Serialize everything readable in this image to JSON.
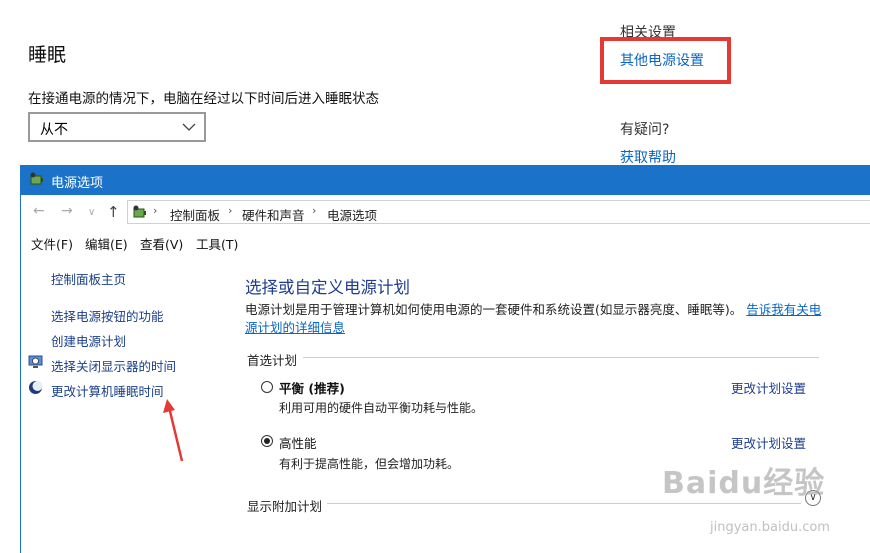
{
  "settings": {
    "sleep_title": "睡眠",
    "sleep_desc": "在接通电源的情况下，电脑在经过以下时间后进入睡眠状态",
    "sleep_value": "从不",
    "related_title": "相关设置",
    "other_power_link": "其他电源设置",
    "question_title": "有疑问?",
    "help_link": "获取帮助"
  },
  "window": {
    "title": "电源选项",
    "breadcrumb": [
      "控制面板",
      "硬件和声音",
      "电源选项"
    ],
    "menu": [
      "文件(F)",
      "编辑(E)",
      "查看(V)",
      "工具(T)"
    ]
  },
  "sidebar": {
    "items": [
      {
        "label": "控制面板主页",
        "icon": ""
      },
      {
        "label": "选择电源按钮的功能",
        "icon": ""
      },
      {
        "label": "创建电源计划",
        "icon": ""
      },
      {
        "label": "选择关闭显示器的时间",
        "icon": "monitor-clock-icon"
      },
      {
        "label": "更改计算机睡眠时间",
        "icon": "moon-icon"
      }
    ]
  },
  "main": {
    "title": "选择或自定义电源计划",
    "desc_text": "电源计划是用于管理计算机如何使用电源的一套硬件和系统设置(如显示器亮度、睡眠等)。",
    "desc_link": "告诉我有关电源计划的详细信息",
    "preferred_label": "首选计划",
    "plans": [
      {
        "name": "平衡 (推荐)",
        "desc": "利用可用的硬件自动平衡功耗与性能。",
        "link": "更改计划设置",
        "selected": false
      },
      {
        "name": "高性能",
        "desc": "有利于提高性能，但会增加功耗。",
        "link": "更改计划设置",
        "selected": true
      }
    ],
    "extra_label": "显示附加计划"
  },
  "watermark": {
    "line1": "Baidu经验",
    "line2": "jingyan.baidu.com"
  },
  "colors": {
    "accent": "#1a73c8",
    "highlight": "#e53935",
    "link": "#0a66c2"
  }
}
